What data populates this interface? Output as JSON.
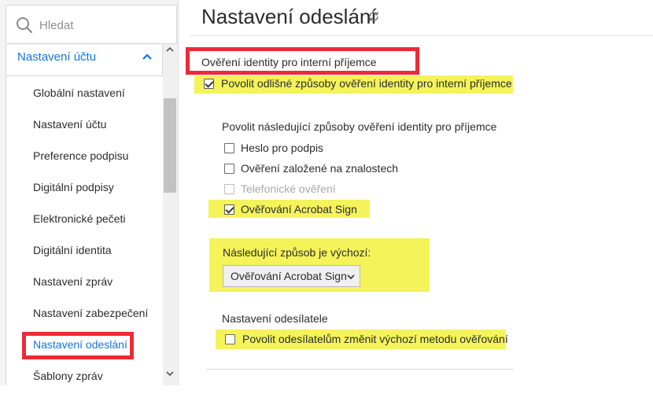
{
  "sidebar": {
    "search": {
      "placeholder": "Hledat",
      "icon": "search-icon"
    },
    "section": {
      "label": "Nastavení účtu",
      "icon": "chevron-up-icon",
      "accent": "#1473e6"
    },
    "items": [
      {
        "label": "Globální nastavení"
      },
      {
        "label": "Nastavení účtu"
      },
      {
        "label": "Preference podpisu"
      },
      {
        "label": "Digitální podpisy"
      },
      {
        "label": "Elektronické pečeti"
      },
      {
        "label": "Digitální identita"
      },
      {
        "label": "Nastavení zpráv"
      },
      {
        "label": "Nastavení zabezpečení"
      },
      {
        "label": "Nastavení odeslání",
        "active": true
      },
      {
        "label": "Šablony zpráv"
      }
    ]
  },
  "main": {
    "title": "Nastavení odeslání",
    "title_icon": "refresh-icon",
    "section_heading": "Ověření identity pro interní příjemce",
    "allow_different": {
      "label": "Povolit odlišné způsoby ověření identity pro interní příjemce",
      "checked": true
    },
    "methods_heading": "Povolit následující způsoby ověření identity pro příjemce",
    "methods": [
      {
        "label": "Heslo pro podpis",
        "checked": false,
        "disabled": false
      },
      {
        "label": "Ověření založené na znalostech",
        "checked": false,
        "disabled": false
      },
      {
        "label": "Telefonické ověření",
        "checked": false,
        "disabled": true
      },
      {
        "label": "Ověřování Acrobat Sign",
        "checked": true,
        "disabled": false
      }
    ],
    "default_method": {
      "label": "Následující způsob je výchozí:",
      "selected": "Ověřování Acrobat Sign"
    },
    "sender_settings": {
      "heading": "Nastavení odesílatele",
      "allow_change": {
        "label": "Povolit odesílatelům změnit výchozí metodu ověřování",
        "checked": false
      }
    }
  },
  "colors": {
    "highlight": "#f4f35a",
    "annotation_red": "#ed2b36",
    "link_blue": "#1473e6"
  }
}
